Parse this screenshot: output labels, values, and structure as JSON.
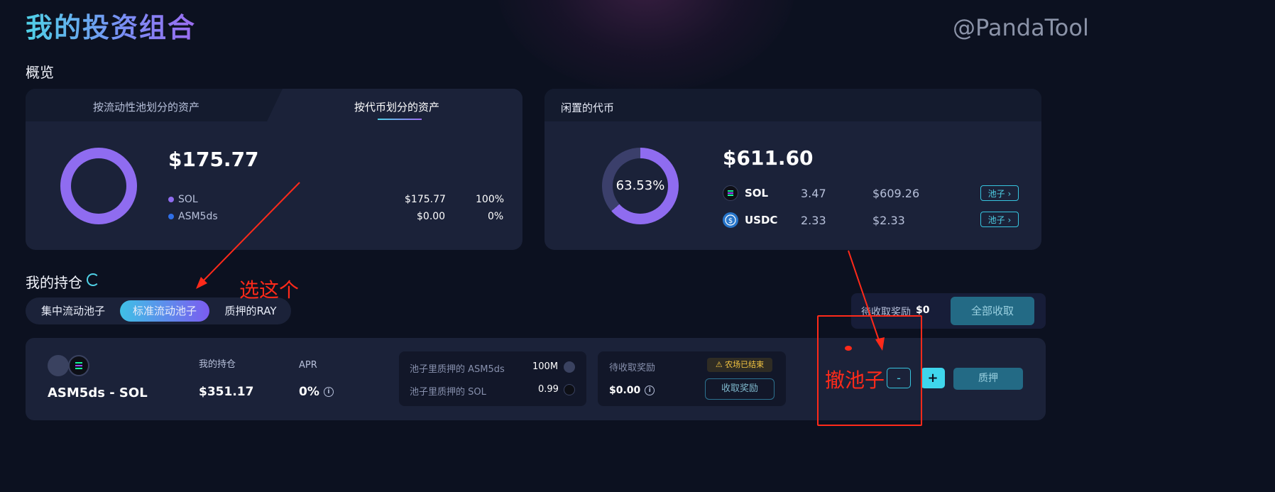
{
  "header": {
    "title": "我的投资组合",
    "watermark": "@PandaTool"
  },
  "overview": {
    "section_title": "概览",
    "assets_card": {
      "tabs": [
        {
          "label": "按流动性池划分的资产",
          "active": false
        },
        {
          "label": "按代币划分的资产",
          "active": true
        }
      ],
      "total": "$175.77",
      "rows": [
        {
          "name": "SOL",
          "value": "$175.77",
          "percent": "100%",
          "color": "#8f6cf0"
        },
        {
          "name": "ASM5ds",
          "value": "$0.00",
          "percent": "0%",
          "color": "#2f6fe8"
        }
      ],
      "donut_share": 1.0
    },
    "idle_card": {
      "title": "闲置的代币",
      "total": "$611.60",
      "donut_label": "63.53%",
      "donut_share": 0.6353,
      "tokens": [
        {
          "symbol": "SOL",
          "amount": "3.47",
          "value": "$609.26",
          "pool_button": "池子",
          "icon": "solana-icon"
        },
        {
          "symbol": "USDC",
          "amount": "2.33",
          "value": "$2.33",
          "pool_button": "池子",
          "icon": "usdc-icon"
        }
      ]
    }
  },
  "holdings": {
    "section_title": "我的持仓",
    "pool_filter": {
      "options": [
        "集中流动池子",
        "标准流动池子",
        "质押的RAY"
      ],
      "selected": "标准流动池子"
    },
    "pending_rewards": {
      "label": "待收取奖励",
      "value": "$0",
      "claim_all": "全部收取"
    },
    "position": {
      "pair": "ASM5ds - SOL",
      "my_position_label": "我的持仓",
      "my_position_value": "$351.17",
      "apr_label": "APR",
      "apr_value": "0%",
      "staked": [
        {
          "label": "池子里质押的 ASM5ds",
          "value": "100M"
        },
        {
          "label": "池子里质押的 SOL",
          "value": "0.99"
        }
      ],
      "rewards_label": "待收取奖励",
      "rewards_value": "$0.00",
      "farm_status": "农场已结束",
      "claim_button": "收取奖励",
      "remove_button": "-",
      "add_button": "+",
      "stake_button": "质押"
    }
  },
  "annotations": {
    "select_hint": "选这个",
    "withdraw_hint": "撤池子",
    "color": "#ff2a1a"
  },
  "colors": {
    "background": "#0c1120",
    "card": "#1b2239",
    "accent_cyan": "#4fd1e6",
    "accent_purple": "#8f6cf0"
  }
}
